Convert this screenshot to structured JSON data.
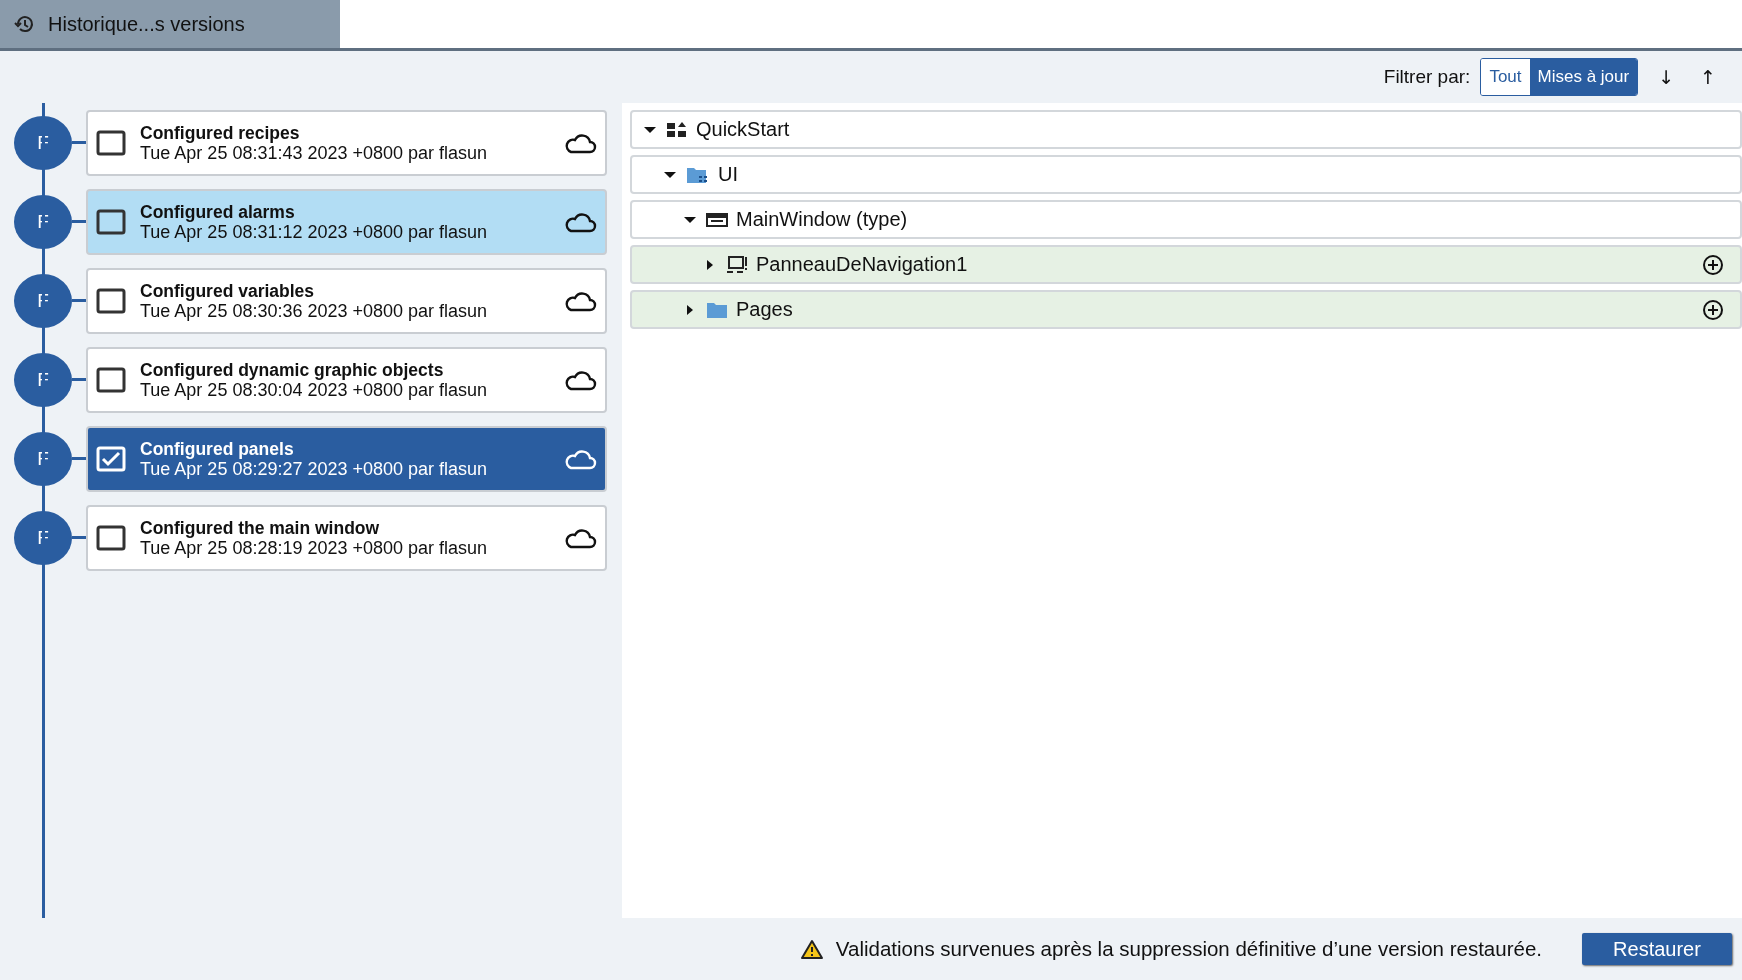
{
  "tab": {
    "title": "Historique...s versions"
  },
  "filter": {
    "label": "Filtrer par:",
    "options": [
      {
        "label": "Tout",
        "selected": false
      },
      {
        "label": "Mises à jour",
        "selected": true
      }
    ],
    "sort": [
      "↓",
      "↑"
    ]
  },
  "versions": [
    {
      "initial": "F",
      "title": "Configured recipes",
      "date": "Tue Apr 25 08:31:43 2023 +0800 par flasun",
      "checked": false,
      "selected": false,
      "highlighted": false
    },
    {
      "initial": "F",
      "title": "Configured alarms",
      "date": "Tue Apr 25 08:31:12 2023 +0800 par flasun",
      "checked": false,
      "selected": false,
      "highlighted": true
    },
    {
      "initial": "F",
      "title": "Configured variables",
      "date": "Tue Apr 25 08:30:36 2023 +0800 par flasun",
      "checked": false,
      "selected": false,
      "highlighted": false
    },
    {
      "initial": "F",
      "title": "Configured dynamic graphic objects",
      "date": "Tue Apr 25 08:30:04 2023 +0800 par flasun",
      "checked": false,
      "selected": false,
      "highlighted": false
    },
    {
      "initial": "F",
      "title": "Configured panels",
      "date": "Tue Apr 25 08:29:27 2023 +0800 par flasun",
      "checked": true,
      "selected": true,
      "highlighted": false
    },
    {
      "initial": "F",
      "title": "Configured the main window",
      "date": "Tue Apr 25 08:28:19 2023 +0800 par flasun",
      "checked": false,
      "selected": false,
      "highlighted": false
    }
  ],
  "tree": [
    {
      "label": "QuickStart",
      "kind": "project",
      "expanded": true,
      "changed": false,
      "children": [
        {
          "label": "UI",
          "kind": "ui-folder",
          "expanded": true,
          "changed": false,
          "children": [
            {
              "label": "MainWindow (type)",
              "kind": "window",
              "expanded": true,
              "changed": false,
              "children": [
                {
                  "label": "PanneauDeNavigation1",
                  "kind": "panel",
                  "expanded": false,
                  "changed": true
                }
              ]
            },
            {
              "label": "Pages",
              "kind": "folder",
              "expanded": false,
              "changed": true
            }
          ]
        }
      ]
    }
  ],
  "footer": {
    "message": "Validations survenues après la suppression définitive d’une version restaurée.",
    "button": "Restaurer"
  }
}
